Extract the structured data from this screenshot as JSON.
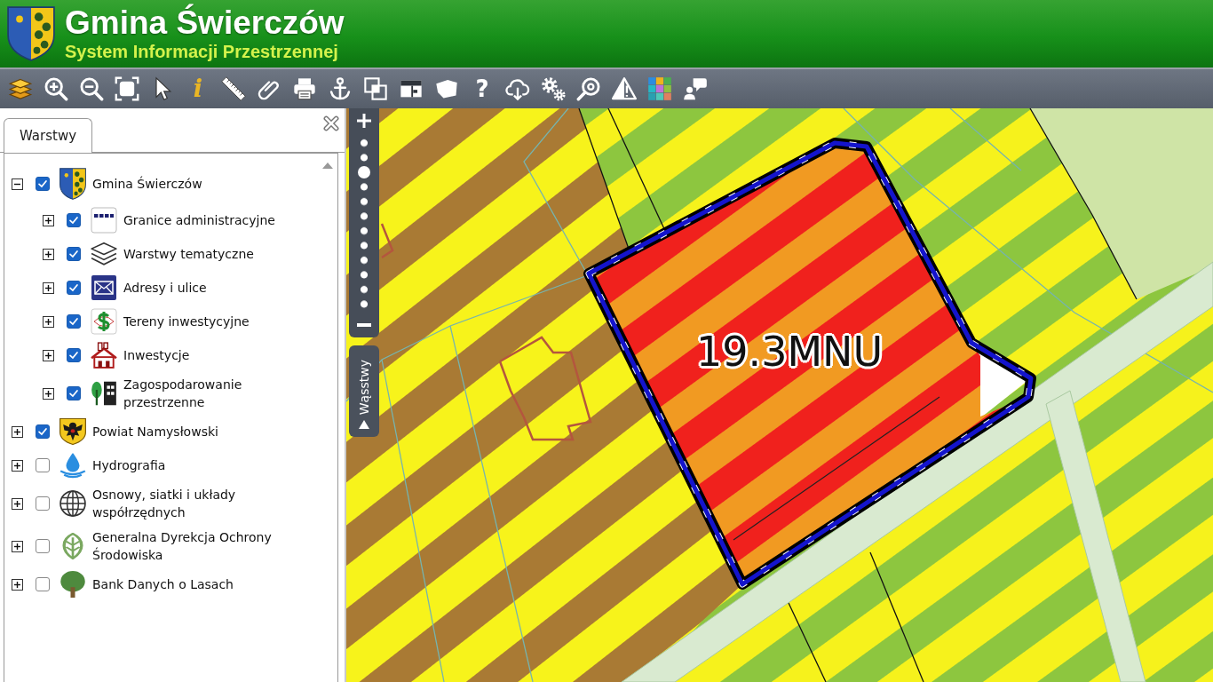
{
  "header": {
    "title": "Gmina Świerczów",
    "subtitle": "System Informacji Przestrzennej"
  },
  "toolbar": {
    "info_glyph": "i",
    "help_glyph": "?"
  },
  "panel": {
    "tabs": [
      {
        "label": "Warstwy",
        "selected": true
      }
    ],
    "layers": [
      {
        "label": "Gmina Świerczów",
        "checked": true,
        "expanded": true,
        "children": [
          {
            "label": "Granice administracyjne",
            "checked": true,
            "expanded": false
          },
          {
            "label": "Warstwy tematyczne",
            "checked": true,
            "expanded": false
          },
          {
            "label": "Adresy i ulice",
            "checked": true,
            "expanded": false
          },
          {
            "label": "Tereny inwestycyjne",
            "checked": true,
            "expanded": false
          },
          {
            "label": "Inwestycje",
            "checked": true,
            "expanded": false
          },
          {
            "label": "Zagospodarowanie przestrzenne",
            "checked": true,
            "expanded": false
          }
        ]
      },
      {
        "label": "Powiat Namysłowski",
        "checked": true,
        "expanded": false
      },
      {
        "label": "Hydrografia",
        "checked": false,
        "expanded": false
      },
      {
        "label": "Osnowy, siatki i układy współrzędnych",
        "checked": false,
        "expanded": false
      },
      {
        "label": "Generalna Dyrekcja Ochrony Środowiska",
        "checked": false,
        "expanded": false
      },
      {
        "label": "Bank Danych o Lasach",
        "checked": false,
        "expanded": false
      }
    ]
  },
  "map": {
    "zoom_slider": {
      "level": 0.82
    },
    "side_tab": {
      "label": "Wąsstwy"
    },
    "parcel_label": "19.3MNU"
  }
}
